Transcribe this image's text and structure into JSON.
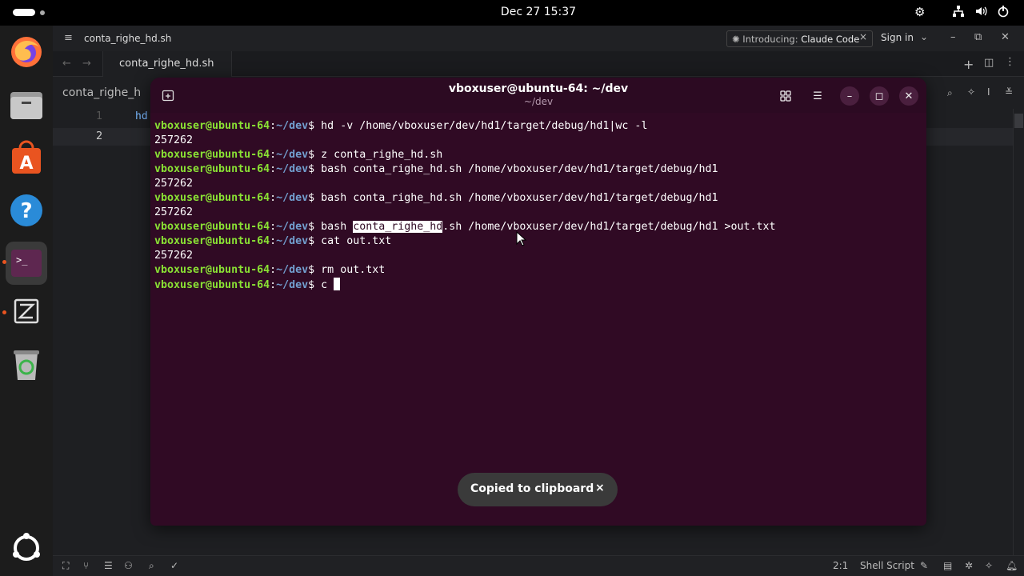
{
  "topbar": {
    "datetime": "Dec 27  15:37"
  },
  "zed": {
    "title": "conta_righe_hd.sh",
    "tab": "conta_righe_hd.sh",
    "banner": "Introducing:",
    "banner_strong": "Claude Code",
    "signin": "Sign in",
    "breadcrumb": "conta_righe_h",
    "lines": [
      {
        "num": "1",
        "code": "hd"
      },
      {
        "num": "2",
        "code": ""
      }
    ],
    "status": {
      "cursor_pos": "2:1",
      "language": "Shell Script"
    }
  },
  "terminal": {
    "title": "vboxuser@ubuntu-64: ~/dev",
    "subtitle": "~/dev",
    "prompt_user": "vboxuser@ubuntu-64",
    "prompt_sep": ":",
    "prompt_path": "~/dev",
    "prompt_dollar": "$ ",
    "lines": [
      {
        "type": "cmd",
        "text": "hd -v /home/vboxuser/dev/hd1/target/debug/hd1|wc -l"
      },
      {
        "type": "out",
        "text": "257262"
      },
      {
        "type": "cmd",
        "text": "z conta_righe_hd.sh"
      },
      {
        "type": "cmd",
        "text": "bash conta_righe_hd.sh /home/vboxuser/dev/hd1/target/debug/hd1"
      },
      {
        "type": "out",
        "text": "257262"
      },
      {
        "type": "cmd",
        "text": "bash conta_righe_hd.sh /home/vboxuser/dev/hd1/target/debug/hd1"
      },
      {
        "type": "out",
        "text": "257262"
      },
      {
        "type": "cmd_sel",
        "pre": "bash ",
        "sel": "conta_righe_hd",
        "post": ".sh /home/vboxuser/dev/hd1/target/debug/hd1 >out.txt"
      },
      {
        "type": "cmd",
        "text": "cat out.txt"
      },
      {
        "type": "out",
        "text": "257262"
      },
      {
        "type": "cmd",
        "text": "rm out.txt"
      },
      {
        "type": "cmd_cursor",
        "text": "c "
      }
    ]
  },
  "toast": {
    "text": "Copied to clipboard",
    "close": "×"
  }
}
